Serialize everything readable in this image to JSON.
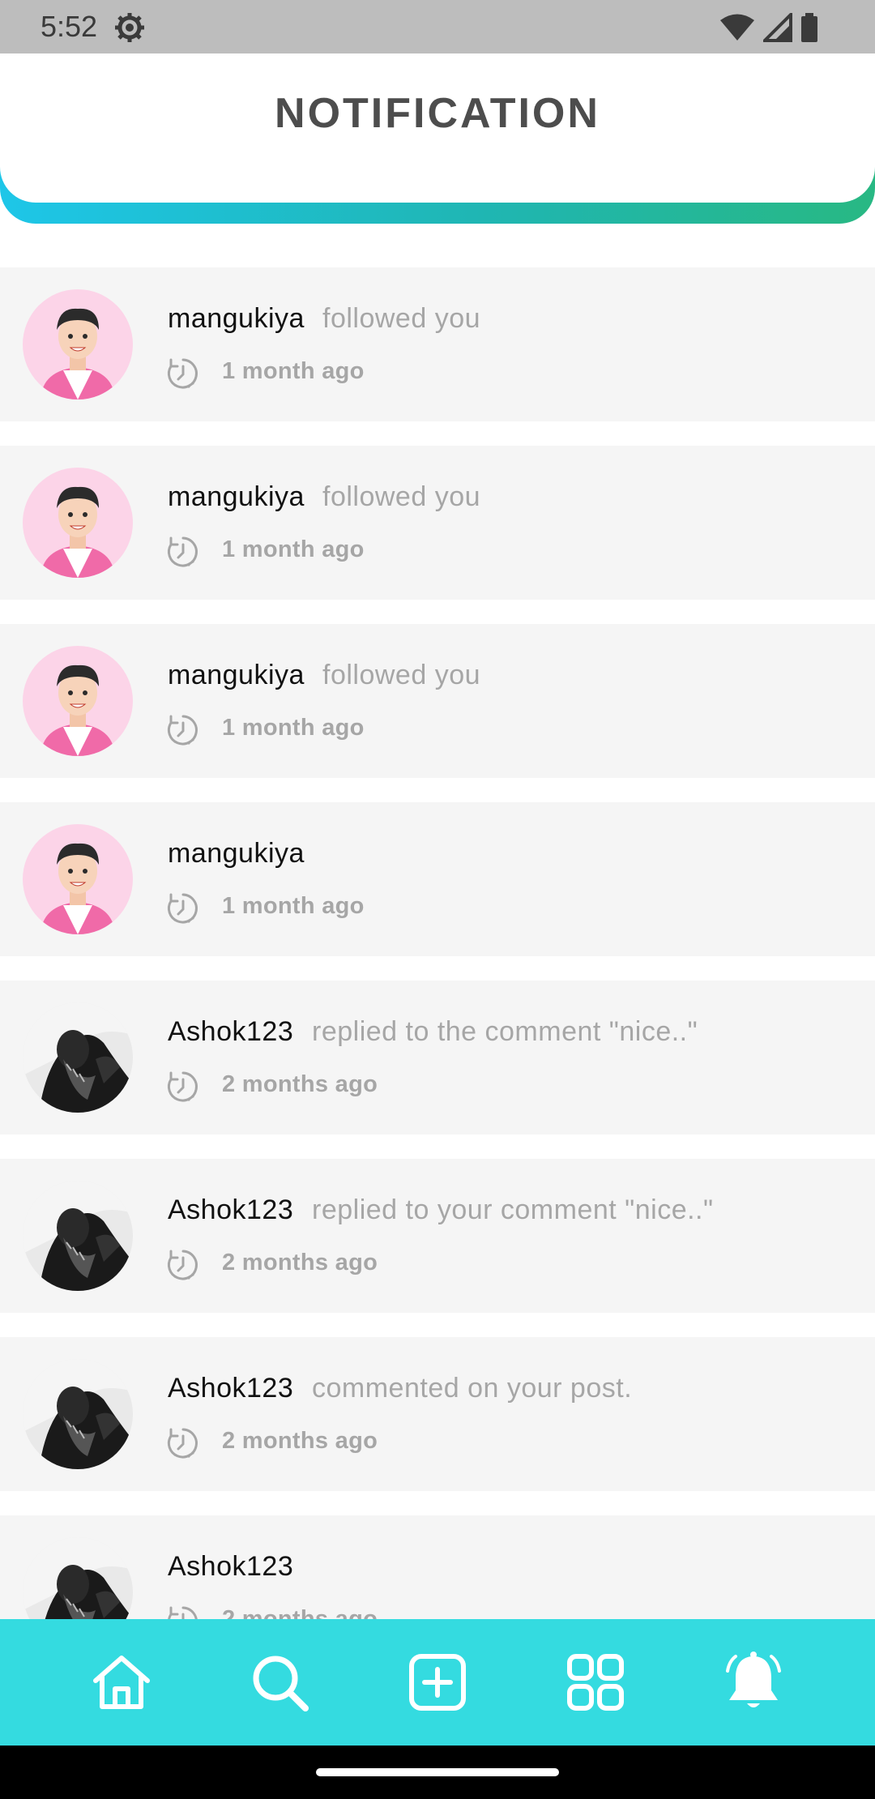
{
  "status_bar": {
    "time": "5:52"
  },
  "header": {
    "title": "NOTIFICATION"
  },
  "notifications": [
    {
      "user": "mangukiya",
      "action": "followed you",
      "time": "1 month ago",
      "avatar": "cartoon-avatar"
    },
    {
      "user": "mangukiya",
      "action": "followed you",
      "time": "1 month ago",
      "avatar": "cartoon-avatar"
    },
    {
      "user": "mangukiya",
      "action": "followed you",
      "time": "1 month ago",
      "avatar": "cartoon-avatar"
    },
    {
      "user": "mangukiya",
      "action": "",
      "time": "1 month ago",
      "avatar": "cartoon-avatar"
    },
    {
      "user": "Ashok123",
      "action": "replied to the comment \"nice..\"",
      "time": "2 months ago",
      "avatar": "photo-avatar"
    },
    {
      "user": "Ashok123",
      "action": "replied to your comment \"nice..\"",
      "time": "2 months ago",
      "avatar": "photo-avatar"
    },
    {
      "user": "Ashok123",
      "action": "commented on your post.",
      "time": "2 months ago",
      "avatar": "photo-avatar"
    },
    {
      "user": "Ashok123",
      "action": "",
      "time": "2 months ago",
      "avatar": "photo-avatar"
    }
  ],
  "bottom_nav": [
    {
      "icon": "home-icon"
    },
    {
      "icon": "search-icon"
    },
    {
      "icon": "add-post-icon"
    },
    {
      "icon": "grid-icon"
    },
    {
      "icon": "bell-icon"
    }
  ],
  "colors": {
    "nav_background": "#34dbe0",
    "header_gradient_start": "#1ec6e8",
    "header_gradient_end": "#28b883",
    "item_background": "#f5f5f5",
    "secondary_text": "#a6a6a6"
  }
}
